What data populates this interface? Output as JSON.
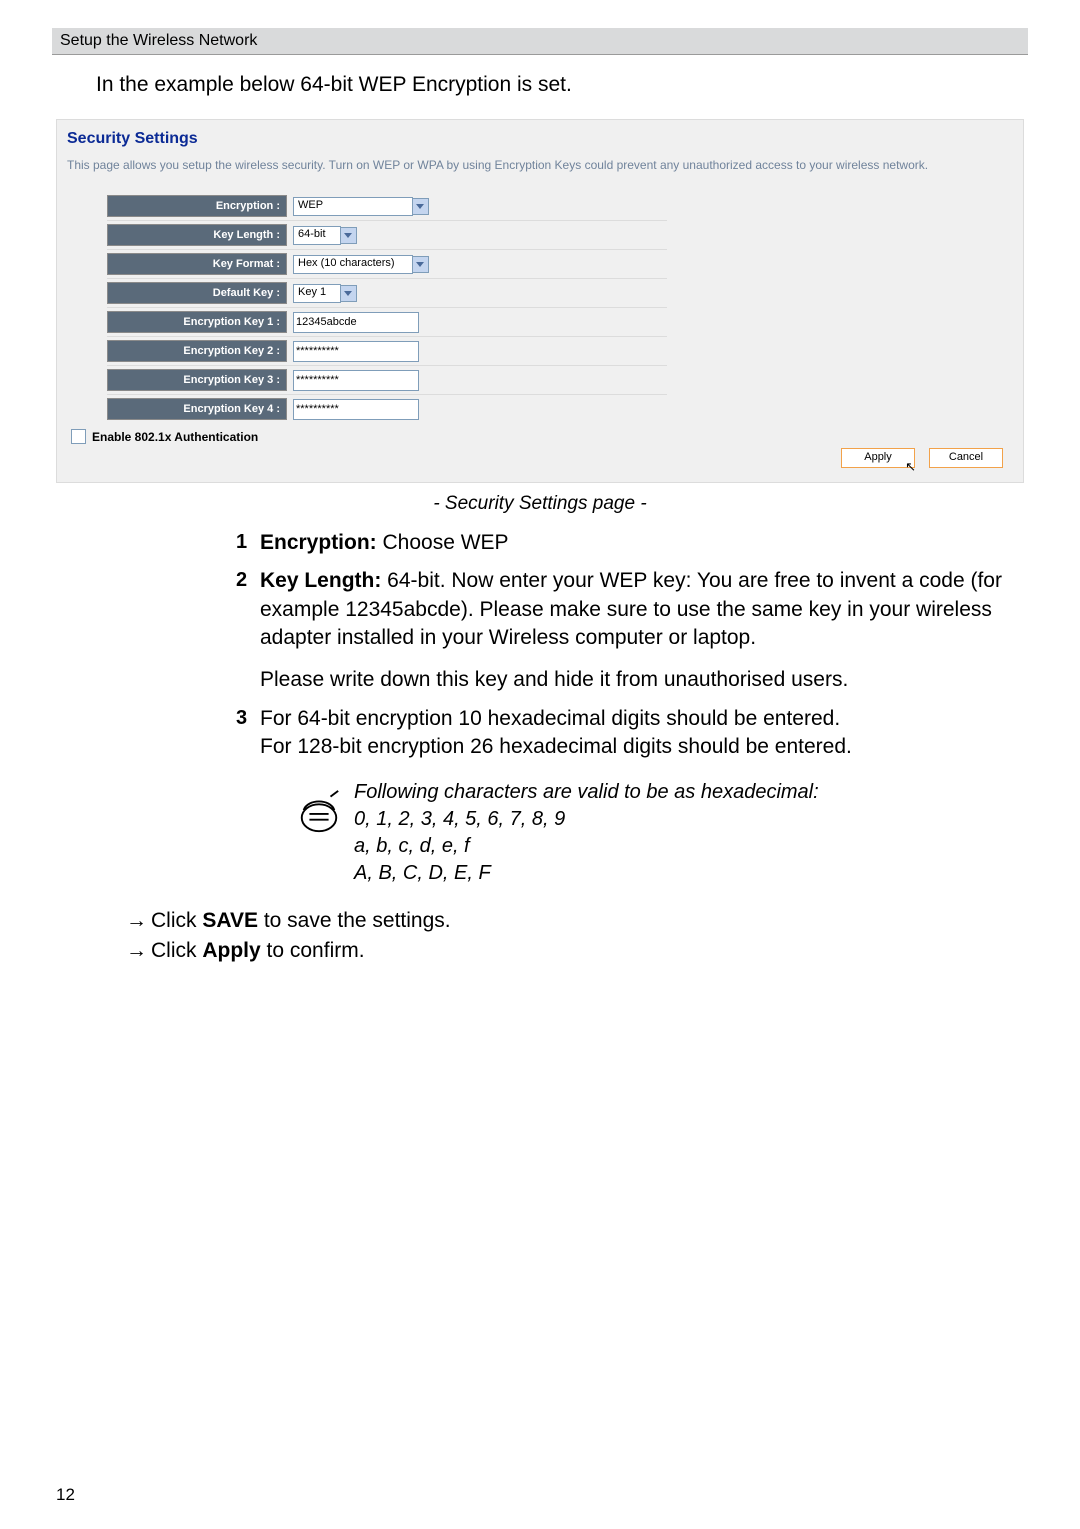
{
  "header": "Setup the Wireless Network",
  "intro": "In the example below 64-bit WEP Encryption is set.",
  "security": {
    "title": "Security Settings",
    "desc": "This page allows you setup the wireless security. Turn on WEP or WPA by using Encryption Keys could prevent any unauthorized access to your wireless network.",
    "rows": {
      "encryption_label": "Encryption :",
      "encryption_value": "WEP",
      "keylength_label": "Key Length :",
      "keylength_value": "64-bit",
      "keyformat_label": "Key Format :",
      "keyformat_value": "Hex (10 characters)",
      "defaultkey_label": "Default Key :",
      "defaultkey_value": "Key 1",
      "k1_label": "Encryption Key 1 :",
      "k1_value": "12345abcde",
      "k2_label": "Encryption Key 2 :",
      "k2_value": "**********",
      "k3_label": "Encryption Key 3 :",
      "k3_value": "**********",
      "k4_label": "Encryption Key 4 :",
      "k4_value": "**********"
    },
    "auth_label": "Enable 802.1x Authentication",
    "apply": "Apply",
    "cancel": "Cancel"
  },
  "caption": "- Security Settings page -",
  "items": {
    "n1": "1",
    "t1_lead": "Encryption:",
    "t1_rest": " Choose WEP",
    "n2": "2",
    "t2_lead": "Key Length:",
    "t2_rest": " 64-bit. Now enter your WEP key: You are free to invent a code (for example 12345abcde). Please make sure to use the same key in your wireless adapter installed in your Wireless computer or laptop.",
    "t2_extra": "Please write down this key and hide it from unauthorised users.",
    "n3": "3",
    "t3_a": "For 64-bit encryption 10 hexadecimal digits should be entered.",
    "t3_b": "For 128-bit encryption 26 hexadecimal digits should be entered."
  },
  "note": {
    "l1": "Following characters are valid to be as hexadecimal:",
    "l2": "0, 1, 2, 3, 4, 5, 6, 7, 8, 9",
    "l3": " a, b, c, d, e, f",
    "l4": "A, B, C, D, E, F"
  },
  "actions": {
    "arrow": "→",
    "a1_pre": "Click ",
    "a1_bold": "SAVE",
    "a1_post": " to save the settings.",
    "a2_pre": "Click ",
    "a2_bold": "Apply",
    "a2_post": " to confirm."
  },
  "page_number": "12"
}
